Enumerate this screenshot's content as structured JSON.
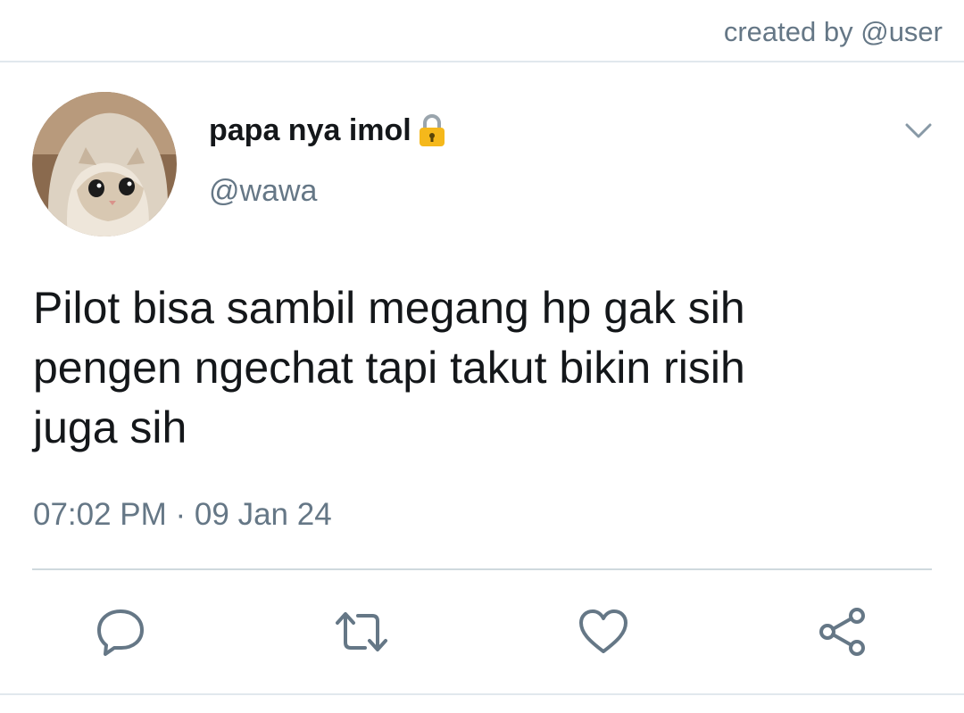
{
  "header": {
    "credit": "created by @user"
  },
  "user": {
    "display_name": "papa nya imol",
    "handle": "@wawa",
    "protected": true
  },
  "tweet": {
    "text": "Pilot bisa sambil megang hp gak sih\npengen ngechat tapi takut bikin risih\njuga sih",
    "timestamp": "07:02 PM · 09 Jan 24"
  },
  "actions": [
    "reply-icon",
    "retweet-icon",
    "like-icon",
    "share-icon"
  ],
  "colors": {
    "text": "#14171a",
    "secondary": "#657786",
    "divider": "#e1e8ed",
    "icon": "#657786",
    "lock": "#f5b81b"
  }
}
